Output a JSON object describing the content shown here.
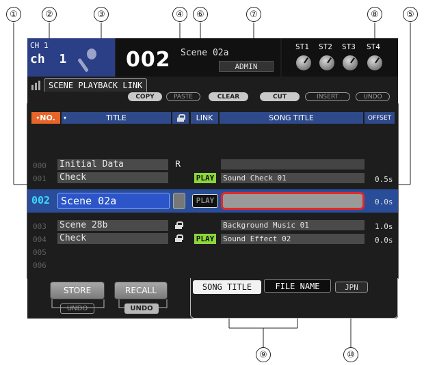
{
  "header": {
    "channel_prefix": "CH",
    "channel_number": "1",
    "channel_name_prefix": "ch",
    "channel_name_number": "1",
    "scene_number": "002",
    "scene_name": "Scene 02a",
    "user": "ADMIN",
    "st_labels": [
      "ST1",
      "ST2",
      "ST3",
      "ST4"
    ]
  },
  "tab": {
    "label": "SCENE PLAYBACK LINK"
  },
  "toolbar": {
    "copy": "COPY",
    "paste": "PASTE",
    "clear": "CLEAR",
    "cut": "CUT",
    "insert": "INSERT",
    "undo": "UNDO"
  },
  "columns": {
    "no": "NO.",
    "title": "TITLE",
    "link": "LINK",
    "song_title": "SONG TITLE",
    "offset": "OFFSET"
  },
  "scenes": [
    {
      "no": "000",
      "title": "Initial Data",
      "flag": "R",
      "play": "",
      "song": "",
      "offset": ""
    },
    {
      "no": "001",
      "title": "Check",
      "flag": "",
      "play": "PLAY",
      "song": "Sound Check 01",
      "offset": "0.5s"
    },
    {
      "no": "002",
      "title": "Scene 02a",
      "flag": "",
      "play": "PLAY",
      "song": "",
      "offset": "0.0s"
    },
    {
      "no": "003",
      "title": "Scene 28b",
      "flag": "lock",
      "play": "",
      "song": "Background Music 01",
      "offset": "1.0s"
    },
    {
      "no": "004",
      "title": "Check",
      "flag": "lock",
      "play": "PLAY",
      "song": "Sound Effect 02",
      "offset": "0.0s"
    },
    {
      "no": "005",
      "title": "",
      "flag": "",
      "play": "",
      "song": "",
      "offset": ""
    },
    {
      "no": "006",
      "title": "",
      "flag": "",
      "play": "",
      "song": "",
      "offset": ""
    }
  ],
  "bottom": {
    "store": "STORE",
    "recall": "RECALL",
    "store_undo": "UNDO",
    "recall_undo": "UNDO",
    "song_title_btn": "SONG TITLE",
    "file_name_btn": "FILE NAME",
    "jpn_btn": "JPN"
  },
  "callouts": [
    "①",
    "②",
    "③",
    "④",
    "⑤",
    "⑥",
    "⑦",
    "⑧",
    "⑨",
    "⑩"
  ],
  "colors": {
    "header_blue": "#2f4a8a",
    "selected_row": "#2a4d99",
    "play_green": "#8bd63a",
    "edit_red": "#e02a2a",
    "no_orange": "#e8652a"
  }
}
